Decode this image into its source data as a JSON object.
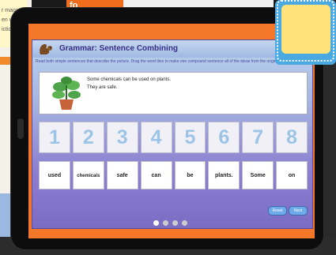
{
  "background": {
    "left_text": [
      "r magazine",
      "en w",
      "ictio"
    ],
    "top_label": "fo"
  },
  "app": {
    "title": "Grammar: Sentence Combining",
    "instructions": "Read both simple sentences that describe the picture. Drag the word tiles to make one compound sentence all of the ideas from the original two sentences.",
    "sentences": [
      "Some chemicals can be used on plants.",
      "They are safe."
    ],
    "numbers": [
      "1",
      "2",
      "3",
      "4",
      "5",
      "6",
      "7",
      "8"
    ],
    "words": [
      "used",
      "chemicals",
      "safe",
      "can",
      "be",
      "plants.",
      "Some",
      "on"
    ],
    "buttons": {
      "reset": "Reset",
      "check": "Next"
    }
  },
  "colors": {
    "screen_frame": "#f5772a",
    "tile_number": "#9cc4e6",
    "app_purple": "#8c7fd0"
  }
}
